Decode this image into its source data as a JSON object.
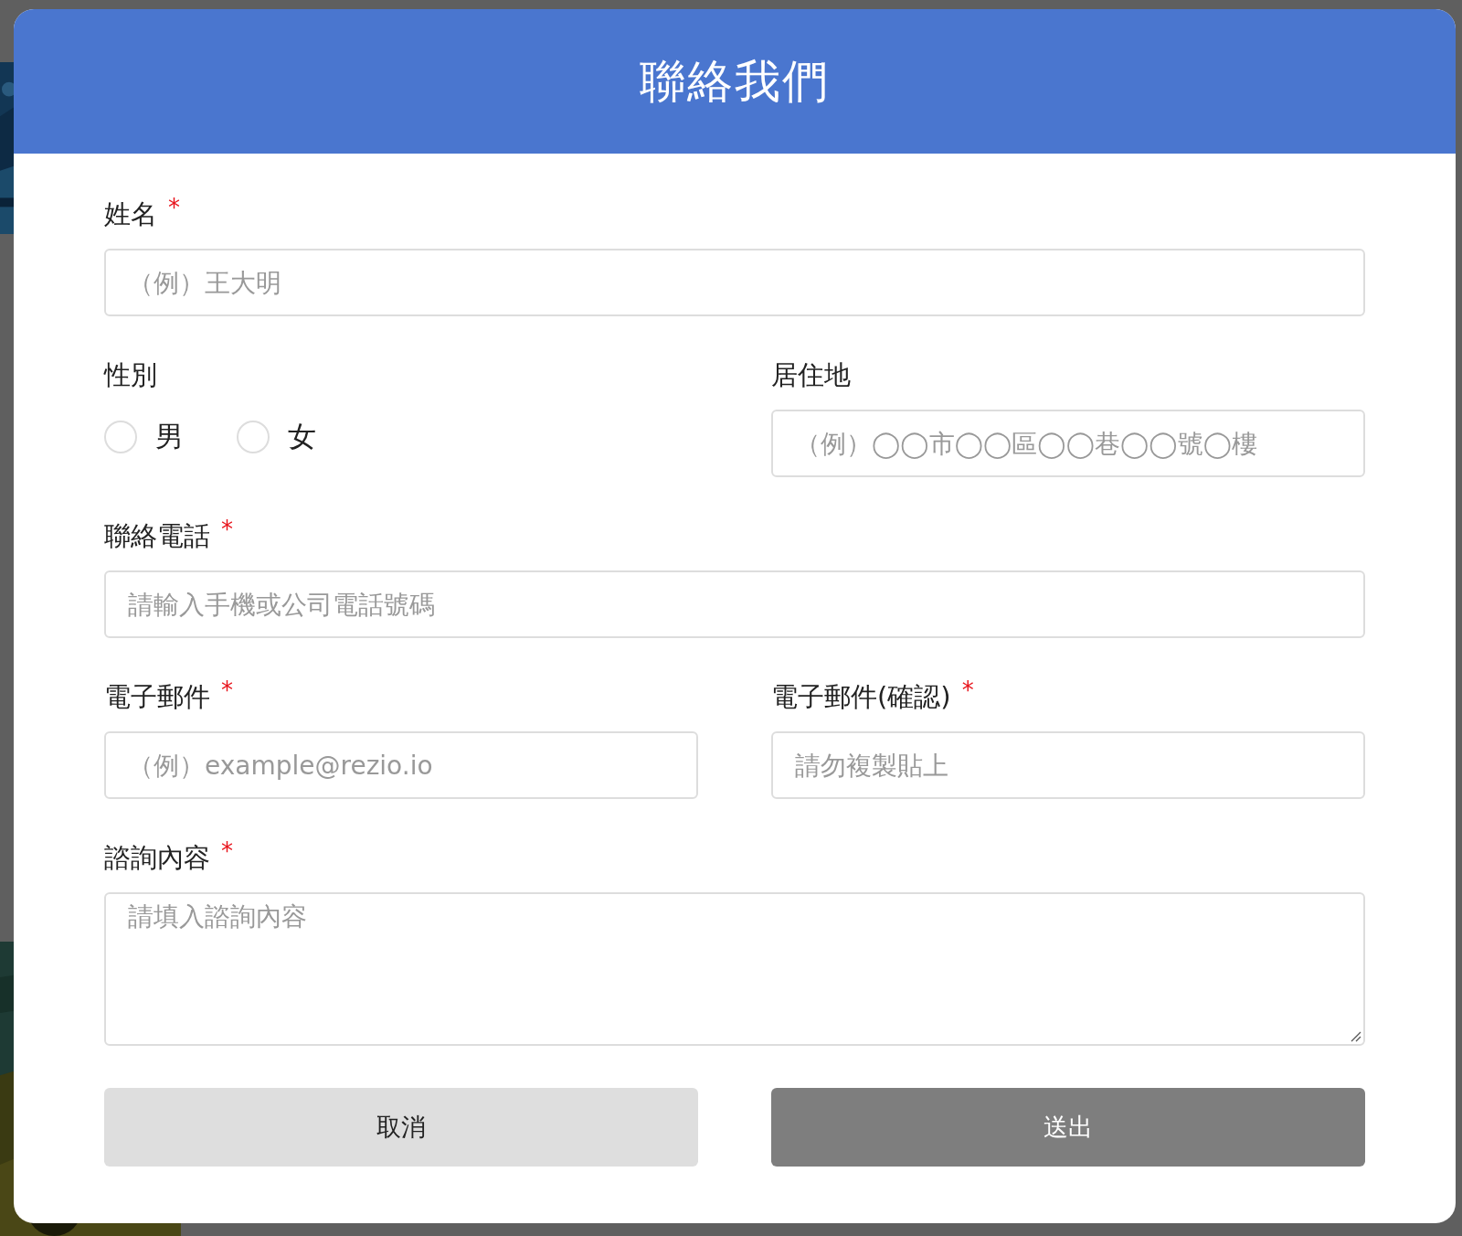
{
  "dialog": {
    "title": "聯絡我們"
  },
  "rows": [
    {
      "fields": [
        {
          "kind": "text",
          "label": "姓名",
          "required_mark": "*",
          "placeholder": "（例）王大明"
        }
      ]
    },
    {
      "fields": [
        {
          "kind": "radio",
          "label": "性別",
          "options": [
            {
              "label": "男",
              "selected": false
            },
            {
              "label": "女",
              "selected": false
            }
          ]
        },
        {
          "kind": "text",
          "label": "居住地",
          "placeholder": "（例）◯◯市◯◯區◯◯巷◯◯號◯樓"
        }
      ]
    },
    {
      "fields": [
        {
          "kind": "text",
          "label": "聯絡電話",
          "required_mark": "*",
          "placeholder": "請輸入手機或公司電話號碼"
        }
      ]
    },
    {
      "fields": [
        {
          "kind": "text",
          "label": "電子郵件",
          "required_mark": "*",
          "placeholder": "（例）example@rezio.io"
        },
        {
          "kind": "text",
          "label": "電子郵件(確認)",
          "required_mark": "*",
          "placeholder": "請勿複製貼上"
        }
      ]
    },
    {
      "fields": [
        {
          "kind": "textarea",
          "label": "諮詢內容",
          "required_mark": "*",
          "placeholder": "請填入諮詢內容"
        }
      ]
    }
  ],
  "buttons": [
    {
      "label": "取消",
      "kind": "cancel"
    },
    {
      "label": "送出",
      "kind": "submit"
    }
  ]
}
